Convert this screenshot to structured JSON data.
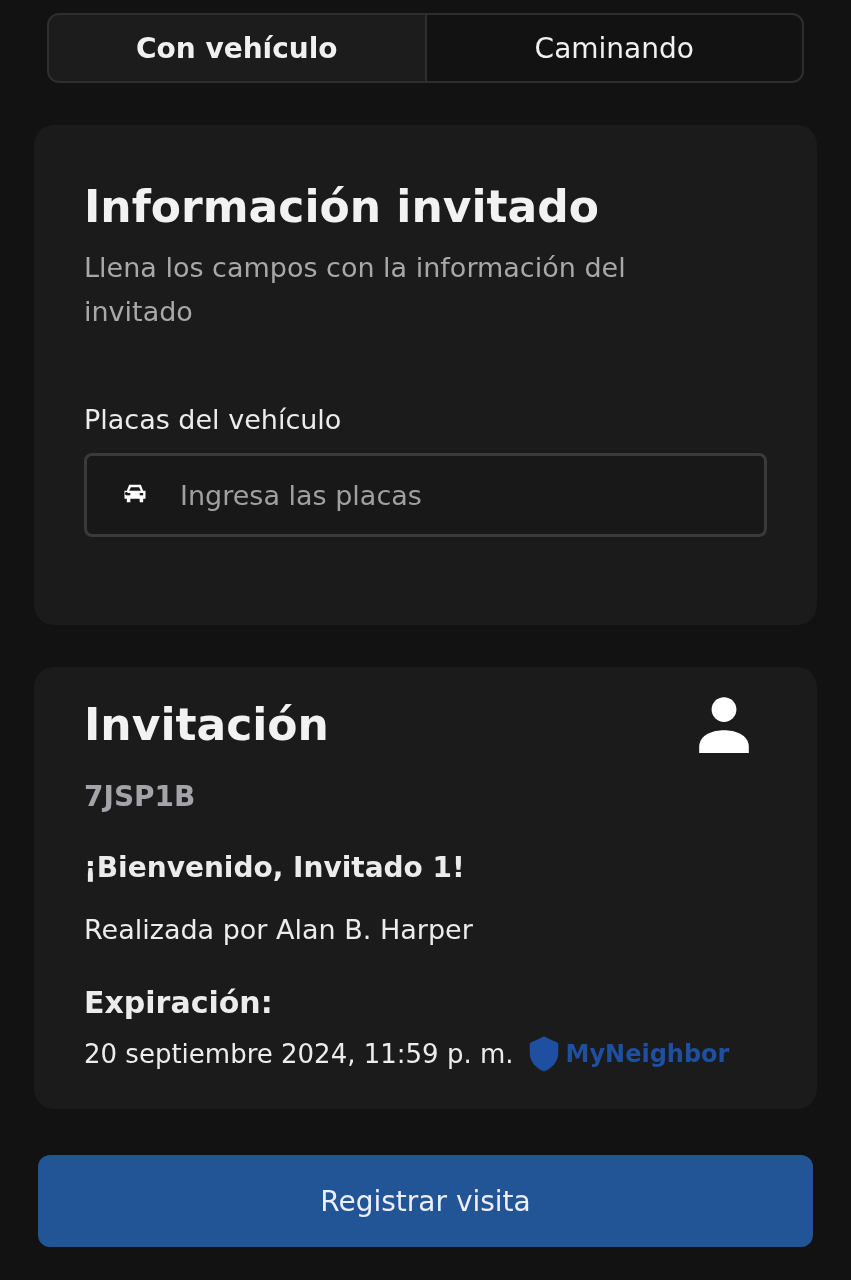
{
  "tabs": [
    {
      "label": "Con vehículo",
      "selected": true
    },
    {
      "label": "Caminando",
      "selected": false
    }
  ],
  "guest_info": {
    "title": "Información invitado",
    "subtitle": "Llena los campos con la información del invitado",
    "field_label": "Placas del vehículo",
    "plates_field": {
      "placeholder": "Ingresa las placas"
    }
  },
  "invitation": {
    "title": "Invitación",
    "code": "7JSP1B",
    "welcome": "¡Bienvenido, Invitado 1!",
    "made_by": "Realizada por Alan B. Harper",
    "expiration_label": "Expiración:",
    "expiration": "20 septiembre 2024, 11:59 p. m.",
    "logo": "MyNeighbor"
  },
  "submit_button": "Registrar visita"
}
